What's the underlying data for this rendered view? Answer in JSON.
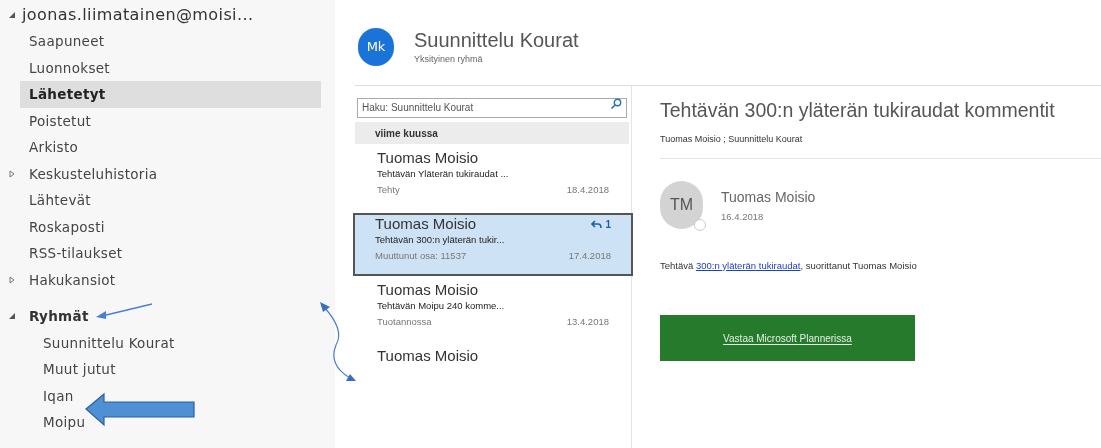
{
  "sidebar": {
    "account": {
      "label": "joonas.liimatainen@moisi...",
      "expanded": true
    },
    "folders": [
      {
        "label": "Saapuneet",
        "selected": false
      },
      {
        "label": "Luonnokset",
        "selected": false
      },
      {
        "label": "Lähetetyt",
        "selected": true
      },
      {
        "label": "Poistetut",
        "selected": false
      },
      {
        "label": "Arkisto",
        "selected": false
      },
      {
        "label": "Keskusteluhistoria",
        "selected": false,
        "expandable": true,
        "expanded": false
      },
      {
        "label": "Lähtevät",
        "selected": false
      },
      {
        "label": "Roskaposti",
        "selected": false
      },
      {
        "label": "RSS-tilaukset",
        "selected": false
      },
      {
        "label": "Hakukansiot",
        "selected": false,
        "expandable": true,
        "expanded": false
      }
    ],
    "groups": {
      "label": "Ryhmät",
      "expanded": true,
      "children": [
        {
          "label": "Suunnittelu Kourat",
          "selected": false
        },
        {
          "label": "Muut jutut",
          "selected": false
        },
        {
          "label": "Iqan",
          "selected": false
        },
        {
          "label": "Moipu",
          "selected": false
        }
      ]
    }
  },
  "group_header": {
    "initials": "Mk",
    "name": "Suunnittelu Kourat",
    "subtitle": "Yksityinen ryhmä"
  },
  "message_list": {
    "search": {
      "placeholder": "Haku: Suunnittelu Kourat"
    },
    "section": "viime kuussa",
    "messages": [
      {
        "sender": "Tuomas Moisio",
        "subject": "Tehtävän Yläterän tukiraudat ...",
        "status": "Tehty",
        "date": "18.4.2018",
        "selected": false
      },
      {
        "sender": "Tuomas Moisio",
        "subject": "Tehtävän 300:n yläterän tukir...",
        "status": "Muuttunut osa: 11537",
        "date": "17.4.2018",
        "selected": true,
        "reply_count": "1"
      },
      {
        "sender": "Tuomas Moisio",
        "subject": "Tehtävän Moipu 240 komme...",
        "status": "Tuotannossa",
        "date": "13.4.2018",
        "selected": false
      },
      {
        "sender": "Tuomas Moisio",
        "selected": false
      }
    ]
  },
  "reading_pane": {
    "title": "Tehtävän 300:n yläterän tukiraudat kommentit",
    "recipients": "Tuomas Moisio ; Suunnittelu Kourat",
    "sender": {
      "initials": "TM",
      "name": "Tuomas Moisio",
      "date": "16.4.2018"
    },
    "body": {
      "before": "Tehtävä",
      "link": "300:n yläterän tukiraudat",
      "after": ", suorittanut Tuomas Moisio"
    },
    "button": "Vastaa Microsoft Plannerissa"
  }
}
